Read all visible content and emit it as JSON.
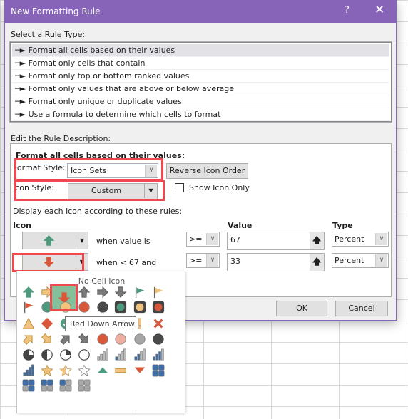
{
  "dialog": {
    "title": "New Formatting Rule",
    "help": "?",
    "close": "✕"
  },
  "rule_type": {
    "label": "Select a Rule Type:",
    "items": [
      {
        "label": "Format all cells based on their values",
        "selected": true
      },
      {
        "label": "Format only cells that contain"
      },
      {
        "label": "Format only top or bottom ranked values"
      },
      {
        "label": "Format only values that are above or below average"
      },
      {
        "label": "Format only unique or duplicate values"
      },
      {
        "label": "Use a formula to determine which cells to format"
      }
    ]
  },
  "description": {
    "label": "Edit the Rule Description:",
    "heading": "Format all cells based on their values:",
    "format_style_label": "Format Style:",
    "format_style_value": "Icon Sets",
    "reverse_button": "Reverse Icon Order",
    "icon_style_label": "Icon Style:",
    "icon_style_value": "Custom",
    "show_icon_only": "Show Icon Only",
    "show_icon_only_checked": false,
    "display_rules": "Display each icon according to these rules:",
    "col_icon": "Icon",
    "col_value": "Value",
    "col_type": "Type",
    "rows": [
      {
        "icon": "green-up-arrow",
        "condition": "when value is",
        "operator": ">=",
        "value": "67",
        "type": "Percent"
      },
      {
        "icon": "red-down-arrow",
        "condition": "when < 67 and",
        "operator": ">=",
        "value": "33",
        "type": "Percent"
      }
    ]
  },
  "icon_picker": {
    "no_icon": "No Cell Icon",
    "tooltip": "Red Down Arrow",
    "selected_index": 2,
    "icons": [
      {
        "k": "arrow",
        "d": "up",
        "c": "#4e9a7c"
      },
      {
        "k": "arrow",
        "d": "right",
        "c": "#f0c27b"
      },
      {
        "k": "arrow",
        "d": "down",
        "c": "#d9583b"
      },
      {
        "k": "arrow",
        "d": "up",
        "c": "#7a7a7a"
      },
      {
        "k": "arrow",
        "d": "right",
        "c": "#7a7a7a"
      },
      {
        "k": "arrow",
        "d": "down",
        "c": "#7a7a7a"
      },
      {
        "k": "flag",
        "c": "#4e9a7c"
      },
      {
        "k": "flag",
        "c": "#f0c27b"
      },
      {
        "k": "flag",
        "c": "#d9583b"
      },
      {
        "k": "circle",
        "c": "#4e9a7c"
      },
      {
        "k": "circle",
        "c": "#f0c27b"
      },
      {
        "k": "circle",
        "c": "#d9583b"
      },
      {
        "k": "circle",
        "c": "#4a4a4a"
      },
      {
        "k": "traffic",
        "c": "#4e9a7c"
      },
      {
        "k": "traffic",
        "c": "#f0c27b"
      },
      {
        "k": "traffic",
        "c": "#d9583b"
      },
      {
        "k": "triangle",
        "c": "#f0c27b"
      },
      {
        "k": "diamond",
        "c": "#d9583b"
      },
      {
        "k": "check-circle",
        "c": "#4e9a7c"
      },
      {
        "k": "excl-circle",
        "c": "#f0c27b"
      },
      {
        "k": "x-circle",
        "c": "#d9583b"
      },
      {
        "k": "check",
        "c": "#4e9a7c"
      },
      {
        "k": "excl",
        "c": "#f0c27b"
      },
      {
        "k": "cross",
        "c": "#d9583b"
      },
      {
        "k": "arrow",
        "d": "ur",
        "c": "#f0c27b"
      },
      {
        "k": "arrow",
        "d": "dr",
        "c": "#f0c27b"
      },
      {
        "k": "arrow",
        "d": "ur",
        "c": "#7a7a7a"
      },
      {
        "k": "arrow",
        "d": "dr",
        "c": "#7a7a7a"
      },
      {
        "k": "circle",
        "c": "#d9583b"
      },
      {
        "k": "circle",
        "c": "#f0aea0"
      },
      {
        "k": "circle",
        "c": "#a6a6a6"
      },
      {
        "k": "circle",
        "c": "#4a4a4a"
      },
      {
        "k": "pie",
        "n": 3
      },
      {
        "k": "pie",
        "n": 2
      },
      {
        "k": "pie",
        "n": 1
      },
      {
        "k": "pie",
        "n": 0
      },
      {
        "k": "signal",
        "n": 0
      },
      {
        "k": "signal",
        "n": 1
      },
      {
        "k": "signal",
        "n": 2
      },
      {
        "k": "signal",
        "n": 3
      },
      {
        "k": "signal",
        "n": 4
      },
      {
        "k": "star",
        "n": 2
      },
      {
        "k": "star",
        "n": 1
      },
      {
        "k": "star",
        "n": 0
      },
      {
        "k": "tri-up",
        "c": "#4e9a7c"
      },
      {
        "k": "dash",
        "c": "#f0c27b"
      },
      {
        "k": "tri-down",
        "c": "#d9583b"
      },
      {
        "k": "boxes",
        "n": 4
      },
      {
        "k": "boxes",
        "n": 3
      },
      {
        "k": "boxes",
        "n": 2
      },
      {
        "k": "boxes",
        "n": 1
      },
      {
        "k": "boxes",
        "n": 0
      }
    ]
  },
  "buttons": {
    "ok": "OK",
    "cancel": "Cancel"
  },
  "colors": {
    "titlebar": "#8764b8",
    "highlight": "#f0484e",
    "selected_icon_bg": "#84c19b"
  }
}
